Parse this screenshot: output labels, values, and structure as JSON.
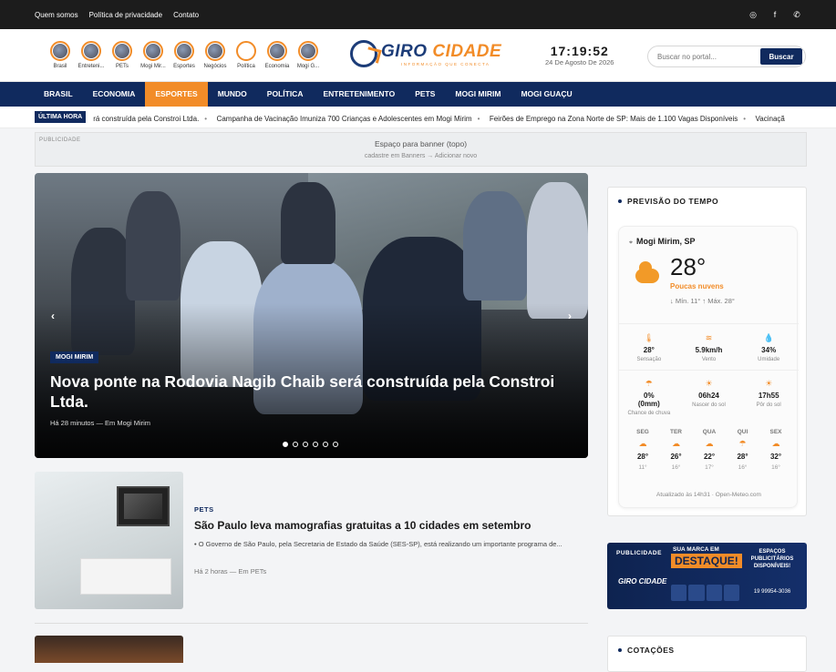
{
  "topbar": {
    "links": [
      "Quem somos",
      "Política de privacidade",
      "Contato"
    ],
    "social": [
      "instagram-icon",
      "facebook-icon",
      "whatsapp-icon"
    ]
  },
  "stories": [
    {
      "label": "Brasil"
    },
    {
      "label": "Entreteni..."
    },
    {
      "label": "PETs"
    },
    {
      "label": "Mogi Mir..."
    },
    {
      "label": "Esportes"
    },
    {
      "label": "Negócios"
    },
    {
      "label": "Política"
    },
    {
      "label": "Economia"
    },
    {
      "label": "Mogi G..."
    }
  ],
  "logo": {
    "name_a": "GIRO",
    "name_b": "CIDADE",
    "tagline": "INFORMAÇÃO QUE CONECTA"
  },
  "clock": {
    "time": "17:19:52",
    "date": "24 De Agosto De 2026"
  },
  "search": {
    "placeholder": "Buscar no portal...",
    "button": "Buscar"
  },
  "nav": {
    "items": [
      "BRASIL",
      "ECONOMIA",
      "ESPORTES",
      "MUNDO",
      "POLÍTICA",
      "ENTRETENIMENTO",
      "PETS",
      "MOGI MIRIM",
      "MOGI GUAÇU"
    ],
    "active": "ESPORTES"
  },
  "ticker": {
    "label": "ÚLTIMA HORA",
    "items": [
      "rá construída pela Constroi Ltda.",
      "Campanha de Vacinação Imuniza 700 Crianças e Adolescentes em Mogi Mirim",
      "Feirões de Emprego na Zona Norte de SP: Mais de 1.100 Vagas Disponíveis",
      "Vacinaçã"
    ]
  },
  "banner": {
    "tag": "PUBLICIDADE",
    "title": "Espaço para banner (topo)",
    "sub": "cadastre em Banners → Adicionar novo"
  },
  "hero": {
    "category": "MOGI MIRIM",
    "title": "Nova ponte na Rodovia Nagib Chaib será construída pela Constroi Ltda.",
    "meta": "Há 28 minutos — Em Mogi Mirim",
    "slides": 6,
    "active_slide": 1
  },
  "article": {
    "category": "PETS",
    "title": "São Paulo leva mamografias gratuitas a 10 cidades em setembro",
    "excerpt": "• O Governo de São Paulo, pela Secretaria de Estado da Saúde (SES-SP), está realizando um importante programa de...",
    "meta": "Há 2 horas — Em PETs"
  },
  "weather": {
    "heading": "PREVISÃO DO TEMPO",
    "city": "Mogi Mirim, SP",
    "temp": "28°",
    "condition": "Poucas nuvens",
    "minmax": "↓ Mín. 11°  ↑ Máx. 28°",
    "row1": [
      {
        "icon": "thermometer-icon",
        "glyph": "🌡",
        "value": "28°",
        "label": "Sensação"
      },
      {
        "icon": "wind-icon",
        "glyph": "≋",
        "value": "5.9km/h",
        "label": "Vento"
      },
      {
        "icon": "humidity-icon",
        "glyph": "💧",
        "value": "34%",
        "label": "Umidade"
      }
    ],
    "row2": [
      {
        "icon": "rain-icon",
        "glyph": "☂",
        "value": "0%\n(0mm)",
        "label": "Chance de chuva"
      },
      {
        "icon": "sunrise-icon",
        "glyph": "☀",
        "value": "06h24",
        "label": "Nascer do sol"
      },
      {
        "icon": "sunset-icon",
        "glyph": "☀",
        "value": "17h55",
        "label": "Pôr do sol"
      }
    ],
    "forecast": [
      {
        "day": "SEG",
        "icon": "cloud-icon",
        "hi": "28°",
        "lo": "11°"
      },
      {
        "day": "TER",
        "icon": "cloud-icon",
        "hi": "26°",
        "lo": "16°"
      },
      {
        "day": "QUA",
        "icon": "cloud-icon",
        "hi": "22°",
        "lo": "17°"
      },
      {
        "day": "QUI",
        "icon": "rain-cloud-icon",
        "hi": "28°",
        "lo": "16°"
      },
      {
        "day": "SEX",
        "icon": "cloud-icon",
        "hi": "32°",
        "lo": "16°"
      }
    ],
    "updated": "Atualizado às 14h31 · Open-Meteo.com"
  },
  "ad": {
    "label": "PUBLICIDADE",
    "brand": "GIRO CIDADE",
    "headline_a": "SUA MARCA EM",
    "headline_b": "DESTAQUE!",
    "side": "ESPAÇOS PUBLICITÁRIOS DISPONÍVEIS!",
    "phone": "19 99954-3036"
  },
  "quotes": {
    "heading": "COTAÇÕES"
  },
  "colors": {
    "navy": "#102a5e",
    "orange": "#f28c28",
    "topbar": "#1c1c1c"
  }
}
